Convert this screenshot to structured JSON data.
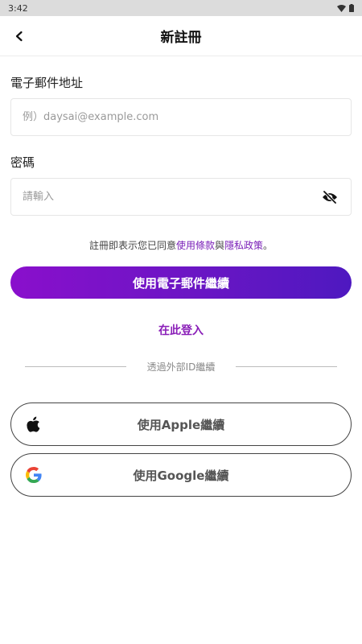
{
  "status": {
    "time": "3:42"
  },
  "header": {
    "title": "新註冊"
  },
  "email": {
    "label": "電子郵件地址",
    "placeholder": "例）daysai@example.com"
  },
  "password": {
    "label": "密碼",
    "placeholder": "請輸入"
  },
  "terms": {
    "prefix": "註冊即表示您已同意",
    "terms_link": "使用條款",
    "middle": "與",
    "privacy_link": "隱私政策",
    "suffix": "。"
  },
  "buttons": {
    "email_continue": "使用電子郵件繼續",
    "login": "在此登入",
    "divider": "透過外部ID繼續",
    "apple": "使用Apple繼續",
    "google": "使用Google繼續"
  },
  "colors": {
    "accent": "#8a1fb8",
    "gradient_start": "#8a0fcc",
    "gradient_end": "#4e18c0"
  },
  "icons": {
    "back": "chevron-left-icon",
    "eye": "eye-off-icon",
    "apple": "apple-logo-icon",
    "google": "google-logo-icon"
  }
}
